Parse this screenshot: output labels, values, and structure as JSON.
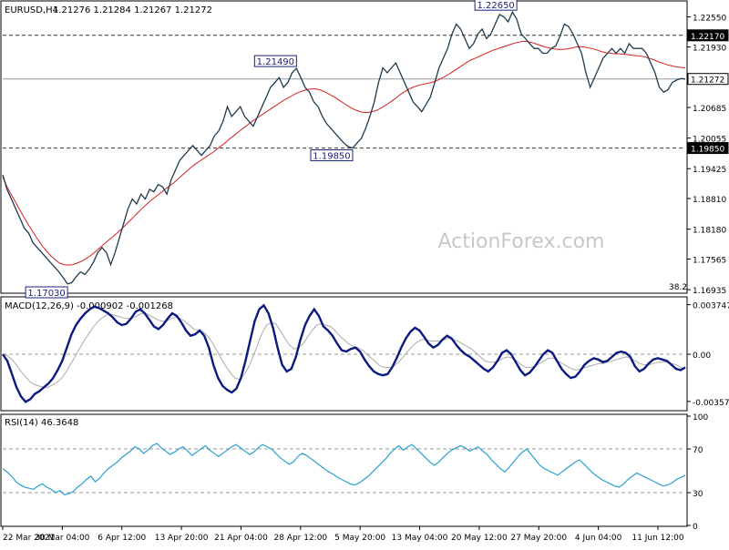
{
  "header": {
    "symbol_timeframe": "EURUSD,H4",
    "ohlc": "1.21276 1.21284 1.21267 1.21272"
  },
  "watermark": "ActionForex.com",
  "colors": {
    "price": "#1f3b4d",
    "ma": "#d42020",
    "macd": "#0a1a80",
    "signal": "#aaaaaa",
    "rsi": "#2aa0d0",
    "level": "#333333",
    "label_box": "#1a237e"
  },
  "chart_data": [
    {
      "type": "line",
      "title": "EURUSD,H4",
      "series": [
        {
          "name": "",
          "values": [
            1.193,
            1.19,
            1.188,
            1.186,
            1.184,
            1.182,
            1.181,
            1.179,
            1.178,
            1.177,
            1.176,
            1.175,
            1.174,
            1.173,
            1.1718,
            1.1705,
            1.1708,
            1.172,
            1.173,
            1.1725,
            1.1735,
            1.175,
            1.177,
            1.178,
            1.177,
            1.1745,
            1.177,
            1.18,
            1.183,
            1.186,
            1.188,
            1.187,
            1.189,
            1.188,
            1.19,
            1.1895,
            1.191,
            1.1905,
            1.189,
            1.192,
            1.194,
            1.196,
            1.197,
            1.198,
            1.199,
            1.198,
            1.197,
            1.198,
            1.199,
            1.201,
            1.202,
            1.204,
            1.207,
            1.205,
            1.206,
            1.207,
            1.205,
            1.204,
            1.203,
            1.205,
            1.207,
            1.209,
            1.211,
            1.212,
            1.213,
            1.211,
            1.212,
            1.214,
            1.2149,
            1.213,
            1.211,
            1.21,
            1.208,
            1.207,
            1.205,
            1.2035,
            1.2025,
            1.2015,
            1.2005,
            1.1995,
            1.1988,
            1.1985,
            1.1995,
            1.2005,
            1.2025,
            1.205,
            1.208,
            1.212,
            1.215,
            1.214,
            1.215,
            1.216,
            1.214,
            1.212,
            1.21,
            1.208,
            1.207,
            1.206,
            1.2075,
            1.209,
            1.212,
            1.215,
            1.217,
            1.219,
            1.222,
            1.224,
            1.223,
            1.221,
            1.219,
            1.22,
            1.222,
            1.223,
            1.221,
            1.222,
            1.224,
            1.226,
            1.2255,
            1.2245,
            1.2265,
            1.225,
            1.222,
            1.221,
            1.22,
            1.219,
            1.219,
            1.218,
            1.218,
            1.219,
            1.2195,
            1.2215,
            1.224,
            1.2235,
            1.222,
            1.22,
            1.218,
            1.214,
            1.211,
            1.213,
            1.215,
            1.217,
            1.218,
            1.219,
            1.218,
            1.219,
            1.218,
            1.22,
            1.219,
            1.219,
            1.219,
            1.218,
            1.216,
            1.214,
            1.211,
            1.21,
            1.2105,
            1.212,
            1.2125,
            1.2128,
            1.21272
          ]
        },
        {
          "name": "",
          "values": [
            1.1925,
            1.1905,
            1.1888,
            1.1872,
            1.1856,
            1.184,
            1.1825,
            1.1811,
            1.1797,
            1.1784,
            1.1773,
            1.1763,
            1.1755,
            1.1748,
            1.1745,
            1.1744,
            1.1745,
            1.1748,
            1.1752,
            1.1757,
            1.1763,
            1.177,
            1.1778,
            1.1786,
            1.1794,
            1.1801,
            1.1809,
            1.1817,
            1.1826,
            1.1835,
            1.1844,
            1.1853,
            1.1862,
            1.187,
            1.1878,
            1.1885,
            1.1892,
            1.1899,
            1.1906,
            1.1913,
            1.1921,
            1.1929,
            1.1937,
            1.1945,
            1.1952,
            1.1958,
            1.1964,
            1.197,
            1.1976,
            1.1983,
            1.199,
            1.1997,
            1.2005,
            1.2012,
            1.2019,
            1.2026,
            1.2033,
            1.204,
            1.2046,
            1.2052,
            1.2058,
            1.2064,
            1.207,
            1.2076,
            1.2082,
            1.2087,
            1.2092,
            1.2097,
            1.2101,
            1.2104,
            1.2106,
            1.2107,
            1.2106,
            1.2103,
            1.2099,
            1.2094,
            1.2089,
            1.2083,
            1.2077,
            1.2071,
            1.2066,
            1.2062,
            1.2059,
            1.2058,
            1.2059,
            1.2061,
            1.2065,
            1.207,
            1.2076,
            1.2082,
            1.2089,
            1.2096,
            1.2102,
            1.2107,
            1.2111,
            1.2114,
            1.2116,
            1.2118,
            1.212,
            1.2123,
            1.2127,
            1.2132,
            1.2137,
            1.2143,
            1.2149,
            1.2155,
            1.2161,
            1.2166,
            1.217,
            1.2174,
            1.2178,
            1.2182,
            1.2186,
            1.2189,
            1.2192,
            1.2195,
            1.2198,
            1.2201,
            1.2203,
            1.2205,
            1.2204,
            1.2202,
            1.2199,
            1.2196,
            1.2193,
            1.2191,
            1.2189,
            1.2188,
            1.2188,
            1.2189,
            1.2191,
            1.2193,
            1.2194,
            1.2193,
            1.2191,
            1.2189,
            1.2186,
            1.2183,
            1.2181,
            1.218,
            1.2179,
            1.2179,
            1.2178,
            1.2177,
            1.2176,
            1.2175,
            1.2174,
            1.2172,
            1.2169,
            1.2166,
            1.2162,
            1.2159,
            1.2156,
            1.2154,
            1.2152,
            1.2151,
            1.215
          ]
        }
      ],
      "ylim": [
        1.1688,
        1.2286
      ],
      "y_ticks": [
        "1.22550",
        "1.21930",
        "1.21310",
        "1.20685",
        "1.20055",
        "1.19425",
        "1.18810",
        "1.18180",
        "1.17565",
        "1.16935"
      ],
      "y_tick_values": [
        1.2255,
        1.2193,
        1.2131,
        1.20685,
        1.20055,
        1.19425,
        1.1881,
        1.1818,
        1.17565,
        1.16935
      ],
      "levels": [
        {
          "label": "1.22170",
          "value": 1.2217,
          "style": "dashed"
        },
        {
          "label": "1.21272",
          "value": 1.21272,
          "style": "solid"
        },
        {
          "label": "1.19850",
          "value": 1.1985,
          "style": "dashed"
        }
      ],
      "annotations": [
        {
          "label": "1.22650",
          "value": 1.2265,
          "at_index": 119
        },
        {
          "label": "1.21490",
          "value": 1.2149,
          "at_index": 68
        },
        {
          "label": "1.19850",
          "value": 1.1985,
          "at_index": 81
        },
        {
          "label": "1.17030",
          "value": 1.1703,
          "at_index": 15
        }
      ],
      "note": "38.2"
    },
    {
      "type": "line",
      "title": "MACD(12,26,9) -0.000902 -0.001268",
      "series": [
        {
          "name": "",
          "values": [
            0.0,
            -0.0005,
            -0.0015,
            -0.0025,
            -0.0032,
            -0.0036,
            -0.0034,
            -0.003,
            -0.0028,
            -0.0025,
            -0.0022,
            -0.0018,
            -0.0012,
            -0.0005,
            0.0005,
            0.0015,
            0.0022,
            0.0027,
            0.0031,
            0.0034,
            0.0036,
            0.0035,
            0.0033,
            0.0031,
            0.0028,
            0.0024,
            0.0022,
            0.0023,
            0.0027,
            0.0032,
            0.0034,
            0.0031,
            0.0026,
            0.0021,
            0.0019,
            0.0022,
            0.0027,
            0.0031,
            0.0029,
            0.0024,
            0.0018,
            0.0014,
            0.0015,
            0.0018,
            0.0014,
            0.0005,
            -0.0008,
            -0.0018,
            -0.0024,
            -0.0027,
            -0.0029,
            -0.0026,
            -0.0018,
            -0.0005,
            0.001,
            0.0025,
            0.0034,
            0.0037,
            0.0031,
            0.002,
            0.0005,
            -0.0008,
            -0.0013,
            -0.0011,
            -0.0002,
            0.0011,
            0.0022,
            0.0029,
            0.0034,
            0.0029,
            0.0021,
            0.0018,
            0.0014,
            0.0008,
            0.0003,
            0.0002,
            0.0004,
            0.0005,
            0.0002,
            -0.0004,
            -0.0009,
            -0.0013,
            -0.0015,
            -0.0016,
            -0.0015,
            -0.001,
            -0.0003,
            0.0005,
            0.0012,
            0.0017,
            0.002,
            0.0018,
            0.0013,
            0.0008,
            0.0005,
            0.0007,
            0.0011,
            0.0014,
            0.0012,
            0.0007,
            0.0003,
            0.0,
            -0.0002,
            -0.0005,
            -0.0008,
            -0.0011,
            -0.0013,
            -0.001,
            -0.0005,
            0.0001,
            0.0003,
            0.0,
            -0.0006,
            -0.0012,
            -0.0016,
            -0.0014,
            -0.001,
            -0.0005,
            0.0,
            0.0003,
            0.0001,
            -0.0005,
            -0.0011,
            -0.0015,
            -0.0018,
            -0.0017,
            -0.0013,
            -0.0008,
            -0.0005,
            -0.0003,
            -0.0004,
            -0.0006,
            -0.0005,
            -0.0002,
            0.0001,
            0.0002,
            0.0001,
            -0.0002,
            -0.0009,
            -0.0013,
            -0.0011,
            -0.0007,
            -0.0004,
            -0.0003,
            -0.0004,
            -0.0005,
            -0.0008,
            -0.0011,
            -0.0012,
            -0.001
          ]
        },
        {
          "name": "",
          "values": [
            0.0,
            -0.0001,
            -0.0004,
            -0.0008,
            -0.0013,
            -0.0017,
            -0.0021,
            -0.0023,
            -0.0024,
            -0.0025,
            -0.0025,
            -0.0023,
            -0.0021,
            -0.0018,
            -0.0013,
            -0.0007,
            -0.0001,
            0.0005,
            0.0011,
            0.0016,
            0.0021,
            0.0025,
            0.0028,
            0.003,
            0.003,
            0.0029,
            0.0028,
            0.0027,
            0.0027,
            0.0028,
            0.003,
            0.0031,
            0.003,
            0.0028,
            0.0026,
            0.0025,
            0.0025,
            0.0027,
            0.0028,
            0.0027,
            0.0025,
            0.0022,
            0.0019,
            0.0018,
            0.0017,
            0.0014,
            0.0009,
            0.0003,
            -0.0003,
            -0.0009,
            -0.0014,
            -0.0018,
            -0.0019,
            -0.0016,
            -0.001,
            -0.0002,
            0.0007,
            0.0016,
            0.0022,
            0.0024,
            0.0023,
            0.0018,
            0.0012,
            0.0007,
            0.0004,
            0.0005,
            0.0008,
            0.0013,
            0.0018,
            0.0022,
            0.0023,
            0.0022,
            0.0021,
            0.0018,
            0.0014,
            0.0011,
            0.0008,
            0.0006,
            0.0005,
            0.0003,
            0.0,
            -0.0003,
            -0.0006,
            -0.0009,
            -0.001,
            -0.001,
            -0.0009,
            -0.0006,
            -0.0002,
            0.0002,
            0.0006,
            0.0009,
            0.0011,
            0.0011,
            0.001,
            0.001,
            0.001,
            0.0011,
            0.0012,
            0.0011,
            0.001,
            0.0008,
            0.0006,
            0.0004,
            0.0001,
            -0.0002,
            -0.0005,
            -0.0006,
            -0.0006,
            -0.0005,
            -0.0003,
            -0.0002,
            -0.0003,
            -0.0005,
            -0.0008,
            -0.001,
            -0.001,
            -0.0009,
            -0.0007,
            -0.0005,
            -0.0003,
            -0.0003,
            -0.0005,
            -0.0007,
            -0.0009,
            -0.0011,
            -0.0012,
            -0.0011,
            -0.001,
            -0.0009,
            -0.0008,
            -0.0007,
            -0.0007,
            -0.0006,
            -0.0005,
            -0.0004,
            -0.0003,
            -0.0002,
            -0.0003,
            -0.0005,
            -0.0007,
            -0.0008,
            -0.0008,
            -0.0007,
            -0.0006,
            -0.0006,
            -0.0006,
            -0.0007,
            -0.0008,
            -0.001,
            -0.0011
          ]
        }
      ],
      "ylim": [
        -0.0042,
        0.0042
      ],
      "y_ticks": [
        "0.003747",
        "0.00",
        "-0.003573"
      ],
      "y_tick_values": [
        0.003747,
        0.0,
        -0.003573
      ]
    },
    {
      "type": "line",
      "title": "RSI(14) 46.3648",
      "series": [
        {
          "name": "",
          "values": [
            52,
            49,
            45,
            40,
            37,
            35,
            34,
            33,
            36,
            38,
            35,
            33,
            30,
            32,
            28,
            29,
            31,
            35,
            38,
            42,
            45,
            40,
            43,
            48,
            52,
            55,
            58,
            62,
            65,
            68,
            72,
            70,
            66,
            69,
            73,
            75,
            71,
            68,
            65,
            67,
            70,
            72,
            68,
            64,
            67,
            70,
            73,
            69,
            66,
            63,
            66,
            69,
            72,
            74,
            71,
            68,
            65,
            67,
            71,
            74,
            72,
            70,
            66,
            62,
            59,
            56,
            58,
            63,
            66,
            64,
            61,
            58,
            55,
            52,
            49,
            47,
            44,
            42,
            40,
            38,
            37,
            39,
            42,
            45,
            49,
            53,
            57,
            61,
            66,
            70,
            73,
            69,
            72,
            74,
            70,
            66,
            62,
            58,
            55,
            58,
            62,
            66,
            69,
            71,
            73,
            71,
            68,
            70,
            72,
            68,
            65,
            60,
            56,
            52,
            49,
            53,
            58,
            63,
            67,
            70,
            65,
            60,
            55,
            52,
            50,
            48,
            46,
            49,
            52,
            55,
            58,
            60,
            56,
            52,
            48,
            45,
            42,
            40,
            38,
            36,
            35,
            38,
            42,
            45,
            48,
            46,
            44,
            42,
            40,
            38,
            36,
            37,
            39,
            42,
            44,
            46
          ]
        }
      ],
      "ylim": [
        0,
        100
      ],
      "y_ticks": [
        "100",
        "70",
        "30",
        "0"
      ],
      "y_tick_values": [
        100,
        70,
        30,
        0
      ],
      "levels": [
        70,
        30
      ]
    }
  ],
  "x_axis": {
    "labels": [
      "22 Mar 2021",
      "30 Mar 04:00",
      "6 Apr 12:00",
      "13 Apr 20:00",
      "21 Apr 04:00",
      "28 Apr 12:00",
      "5 May 20:00",
      "13 May 04:00",
      "20 May 12:00",
      "27 May 20:00",
      "4 Jun 04:00",
      "11 Jun 12:00"
    ]
  }
}
